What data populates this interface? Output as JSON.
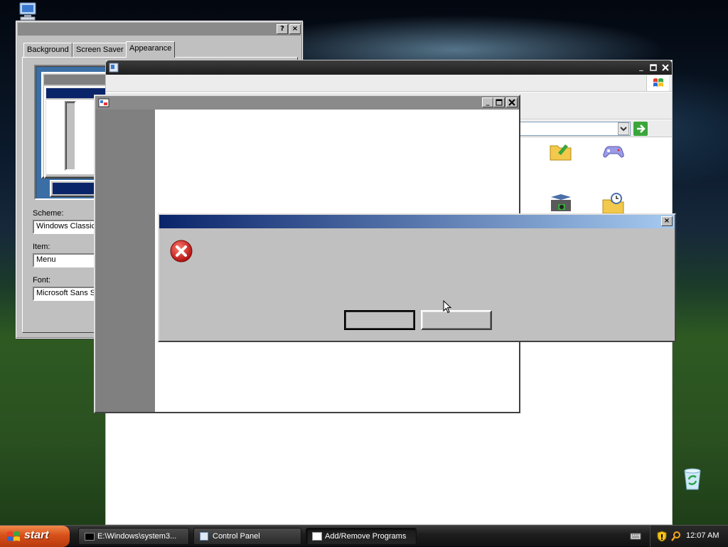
{
  "display_properties": {
    "tabs": [
      "Background",
      "Screen Saver",
      "Appearance"
    ],
    "active_tab": "Appearance",
    "help_button": "?",
    "close_button": "×",
    "scheme_label": "Scheme:",
    "scheme_value": "Windows Classic",
    "item_label": "Item:",
    "item_value": "Menu",
    "font_label": "Font:",
    "font_value": "Microsoft Sans Se"
  },
  "error_dialog": {
    "close_button": "×"
  },
  "taskbar": {
    "start_label": "start",
    "tasks": [
      {
        "label": "E:\\Windows\\system3..."
      },
      {
        "label": "Control Panel"
      },
      {
        "label": "Add/Remove Programs"
      }
    ],
    "active_task": "Add/Remove Programs",
    "clock": "12:07 AM"
  },
  "colors": {
    "dialog_title_start": "#0a246a",
    "dialog_title_end": "#a6caf0",
    "error_red": "#d42020",
    "start_orange": "#e0501a"
  }
}
